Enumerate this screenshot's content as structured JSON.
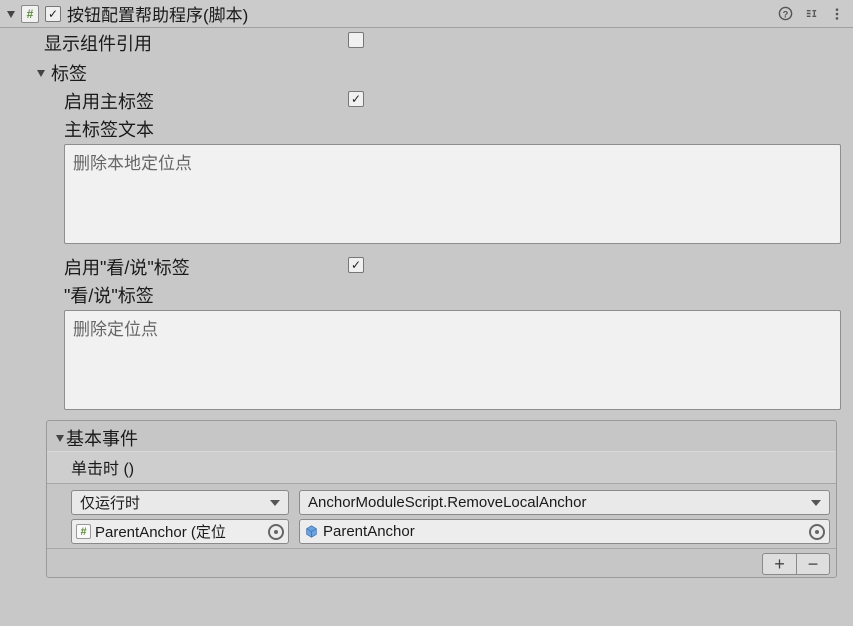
{
  "header": {
    "title": "按钮配置帮助程序(脚本)",
    "script_glyph": "#",
    "enabled": true
  },
  "fields": {
    "show_refs_label": "显示组件引用",
    "show_refs_checked": false
  },
  "labels_section": {
    "title": "标签",
    "enable_main_label": "启用主标签",
    "enable_main_checked": true,
    "main_text_label": "主标签文本",
    "main_text_value": "删除本地定位点",
    "enable_seesay_label": "启用\"看/说\"标签",
    "enable_seesay_checked": true,
    "seesay_label": "\"看/说\"标签",
    "seesay_value": "删除定位点"
  },
  "events_section": {
    "title": "基本事件",
    "onclick_label": "单击时 ()",
    "runtime_mode": "仅运行时",
    "function": "AnchorModuleScript.RemoveLocalAnchor",
    "target_object": "ParentAnchor (定位",
    "argument_object": "ParentAnchor"
  },
  "buttons": {
    "plus": "+",
    "minus": "−"
  }
}
